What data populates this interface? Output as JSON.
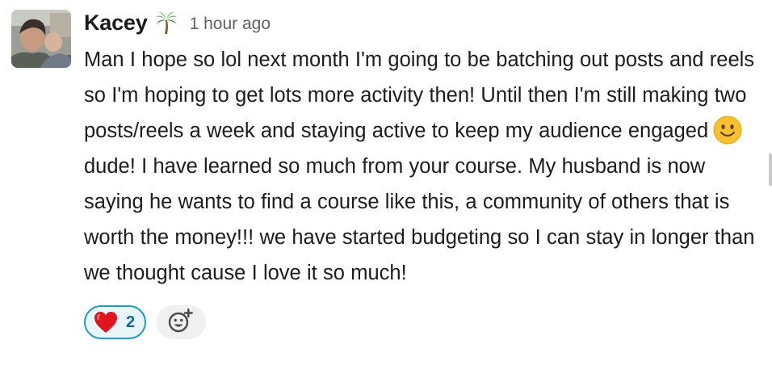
{
  "message": {
    "author": "Kacey",
    "status_emoji": "palm-tree-icon",
    "timestamp": "1 hour ago",
    "text_part1": "Man I hope so lol next month I'm going to be batching out posts and reels so I'm hoping to get lots more activity then! Until then I'm still making two posts/reels a week and staying active to keep my audience engaged",
    "inline_emoji": "slightly-smiling-face-icon",
    "text_part2": "dude! I have learned so much from your course. My husband is now saying he wants to find a course like this, a community of others that is worth the money!!! we have started budgeting so I can stay in longer than we thought cause I love it so much!"
  },
  "reactions": [
    {
      "emoji": "red-heart-icon",
      "count": "2",
      "reacted_by_me": true
    }
  ],
  "add_reaction": {
    "icon": "add-reaction-icon"
  },
  "colors": {
    "text": "#1d1c1d",
    "timestamp": "#616061",
    "reaction_border": "#1d9bd1",
    "reaction_bg": "#e8f5fa",
    "reaction_count": "#1264a3",
    "add_reaction_bg": "#f0f0f0"
  }
}
